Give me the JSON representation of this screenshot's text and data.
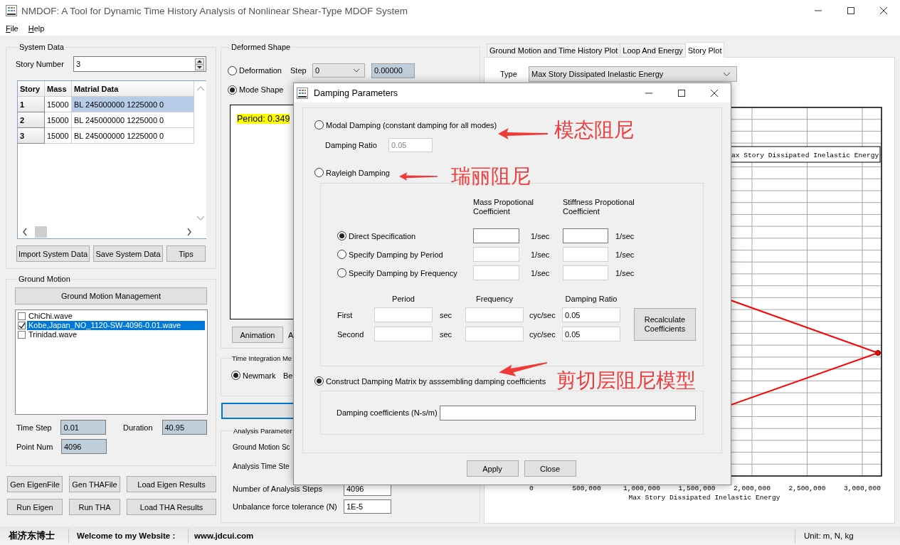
{
  "window": {
    "title": "NMDOF: A Tool for Dynamic Time History Analysis of Nonlinear Shear-Type MDOF System"
  },
  "menu": [
    "File",
    "Help"
  ],
  "system_data": {
    "title": "System Data",
    "story_number_label": "Story Number",
    "story_number": "3",
    "table": {
      "columns": [
        "Story",
        "Mass",
        "Matrial Data"
      ],
      "rows": [
        {
          "story": "1",
          "mass": "15000",
          "material": "BL 245000000 1225000 0",
          "selected": true
        },
        {
          "story": "2",
          "mass": "15000",
          "material": "BL 245000000 1225000 0",
          "selected": false
        },
        {
          "story": "3",
          "mass": "15000",
          "material": "BL 245000000 1225000 0",
          "selected": false
        }
      ]
    },
    "buttons": [
      "Import System Data",
      "Save System Data",
      "Tips"
    ]
  },
  "ground_motion": {
    "title": "Ground Motion",
    "manage_button": "Ground Motion Management",
    "waves": [
      {
        "name": "ChiChi.wave",
        "checked": false,
        "selected": false
      },
      {
        "name": "Kobe,Japan_NO_1120-SW-4096-0.01.wave",
        "checked": true,
        "selected": true
      },
      {
        "name": "Trinidad.wave",
        "checked": false,
        "selected": false
      }
    ],
    "time_step_label": "Time Step",
    "time_step": "0.01",
    "duration_label": "Duration",
    "duration": "40.95",
    "point_num_label": "Point Num",
    "point_num": "4096"
  },
  "action_buttons": [
    "Gen EigenFile",
    "Gen THAFile",
    "Load Eigen Results",
    "Run Eigen",
    "Run THA",
    "Load THA Results"
  ],
  "deformed_shape": {
    "title": "Deformed Shape",
    "options": [
      {
        "label": "Deformation",
        "selected": false
      },
      {
        "label": "Mode Shape",
        "selected": true
      }
    ],
    "step_label": "Step",
    "step": "0",
    "step_value": "0.00000",
    "period": "Period: 0.349",
    "animation_button": "Animation",
    "cut_label": "A"
  },
  "time_integration": {
    "title": "Time Integration Me",
    "options": [
      {
        "label": "Newmark",
        "selected": true
      }
    ],
    "cut_label": "Be"
  },
  "analysis_parameters": {
    "title": "Analysis Parameter",
    "rows": [
      {
        "label": "Ground Motion Sc"
      },
      {
        "label": "Analysis Time Ste"
      },
      {
        "label": "Number of Analysis Steps",
        "value": "4096"
      },
      {
        "label": "Unbalance force tolerance (N)",
        "value": "1E-5"
      }
    ]
  },
  "plot_tabs": [
    {
      "label": "Ground Motion and Time History Plot",
      "selected": false
    },
    {
      "label": "Loop And Energy",
      "selected": false
    },
    {
      "label": "Story Plot",
      "selected": true
    }
  ],
  "story_plot": {
    "type_label": "Type",
    "type": "Max Story Dissipated Inelastic Energy",
    "legend": "ax Story Dissipated Inelastic Energy",
    "x_ticks": [
      "0",
      "500,000",
      "1,000,000",
      "1,500,000",
      "2,000,000",
      "2,500,000",
      "3,000,000"
    ],
    "x_title": "Max Story Dissipated Inelastic Energy"
  },
  "dialog": {
    "title": "Damping Parameters",
    "modal": {
      "label": "Modal Damping (constant damping for all modes)",
      "selected": false,
      "ratio_label": "Damping Ratio",
      "ratio": "0.05"
    },
    "rayleigh": {
      "label": "Rayleigh Damping",
      "selected": false,
      "column_headers": [
        "Mass Propotional Coefficient",
        "Stiffness Propotional Coefficient"
      ],
      "methods": [
        {
          "label": "Direct Specification",
          "selected": true,
          "mass_unit": "1/sec",
          "stiffness_unit": "1/sec"
        },
        {
          "label": "Specify Damping by Period",
          "selected": false,
          "mass_unit": "1/sec",
          "stiffness_unit": "1/sec"
        },
        {
          "label": "Specify Damping by Frequency",
          "selected": false,
          "mass_unit": "1/sec",
          "stiffness_unit": "1/sec"
        }
      ],
      "mode_headers": [
        "Period",
        "Frequency",
        "Damping Ratio"
      ],
      "modes": [
        {
          "label": "First",
          "period_unit": "sec",
          "freq_unit": "cyc/sec",
          "ratio": "0.05"
        },
        {
          "label": "Second",
          "period_unit": "sec",
          "freq_unit": "cyc/sec",
          "ratio": "0.05"
        }
      ],
      "recalc_button": "Recalculate Coefficients"
    },
    "matrix": {
      "label": "Construct Damping Matrix by asssembling damping coefficients",
      "selected": true,
      "coef_label": "Damping coefficients (N-s/m)"
    },
    "buttons": [
      "Apply",
      "Close"
    ]
  },
  "annotations": [
    {
      "text": "模态阻尼"
    },
    {
      "text": "瑞丽阻尼"
    },
    {
      "text": "剪切层阻尼模型"
    }
  ],
  "status_bar": [
    "崔济东博士",
    "Welcome to my Website :",
    "www.jdcui.com",
    "Unit: m, N, kg"
  ]
}
